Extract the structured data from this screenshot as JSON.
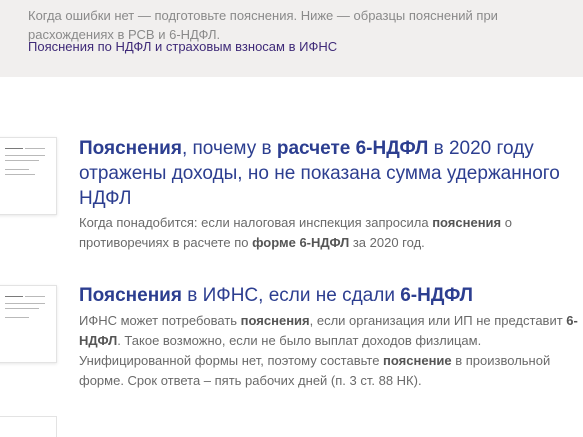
{
  "intro": {
    "text": "Когда ошибки нет — подготовьте пояснения. Ниже — образцы пояснений при расхождениях в РСВ и 6-НДФЛ."
  },
  "top_link": {
    "label": "Пояснения по НДФЛ и страховым взносам в ИФНС"
  },
  "articles": [
    {
      "title": [
        {
          "t": "Пояснения",
          "b": true
        },
        {
          "t": ", почему в ",
          "b": false
        },
        {
          "t": "расчете 6-НДФЛ",
          "b": true
        },
        {
          "t": " в 2020 году отражены доходы, но не показана сумма удержанного НДФЛ",
          "b": false
        }
      ],
      "description": [
        {
          "t": "Когда понадобится: если налоговая инспекция запросила ",
          "b": false
        },
        {
          "t": "пояснения",
          "b": true
        },
        {
          "t": " о противоречиях в расчете по ",
          "b": false
        },
        {
          "t": "форме 6-НДФЛ",
          "b": true
        },
        {
          "t": " за 2020 год.",
          "b": false
        }
      ]
    },
    {
      "title": [
        {
          "t": "Пояснения",
          "b": true
        },
        {
          "t": " в ИФНС, если не сдали ",
          "b": false
        },
        {
          "t": "6-НДФЛ",
          "b": true
        }
      ],
      "description": [
        {
          "t": "ИФНС может потребовать ",
          "b": false
        },
        {
          "t": "пояснения",
          "b": true
        },
        {
          "t": ", если организация или ИП не представит ",
          "b": false
        },
        {
          "t": "6-НДФЛ",
          "b": true
        },
        {
          "t": ". Такое возможно, если не было выплат доходов физлицам. Унифицированной формы нет, поэтому составьте ",
          "b": false
        },
        {
          "t": "пояснение",
          "b": true
        },
        {
          "t": " в произвольной форме. Срок ответа – пять рабочих дней (п. 3 ст. 88 НК).",
          "b": false
        }
      ]
    }
  ],
  "colors": {
    "panel_bg": "#f1efee",
    "title": "#2c3e90",
    "link": "#3f2a78",
    "muted_text": "#6a6a6a"
  },
  "icons": {
    "document_thumbnail": "document-thumbnail-icon"
  }
}
